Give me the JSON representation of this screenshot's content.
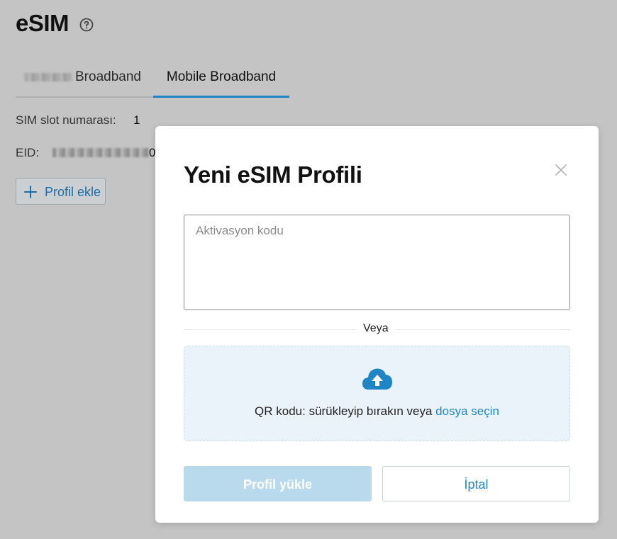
{
  "page": {
    "title": "eSIM"
  },
  "tabs": [
    {
      "label": "Broadband",
      "active": false
    },
    {
      "label": "Mobile Broadband",
      "active": true
    }
  ],
  "info": {
    "slot_label": "SIM slot numarası:",
    "slot_value": "1",
    "eid_label": "EID:",
    "eid_tail": "0"
  },
  "add_profile": {
    "label": "Profil ekle"
  },
  "modal": {
    "title": "Yeni eSIM Profili",
    "activation_placeholder": "Aktivasyon kodu",
    "divider_label": "Veya",
    "dropzone_text": "QR kodu: sürükleyip bırakın veya",
    "dropzone_link": "dosya seçin",
    "primary_button": "Profil yükle",
    "secondary_button": "İptal"
  },
  "colors": {
    "accent": "#1f86c6",
    "primary_disabled": "#b9d9ec",
    "dropzone_bg": "#eaf3f9",
    "overlay": "#c4c4c4"
  },
  "icons": {
    "help": "help-circle-icon",
    "plus": "plus-icon",
    "close": "close-icon",
    "upload": "cloud-upload-icon"
  }
}
